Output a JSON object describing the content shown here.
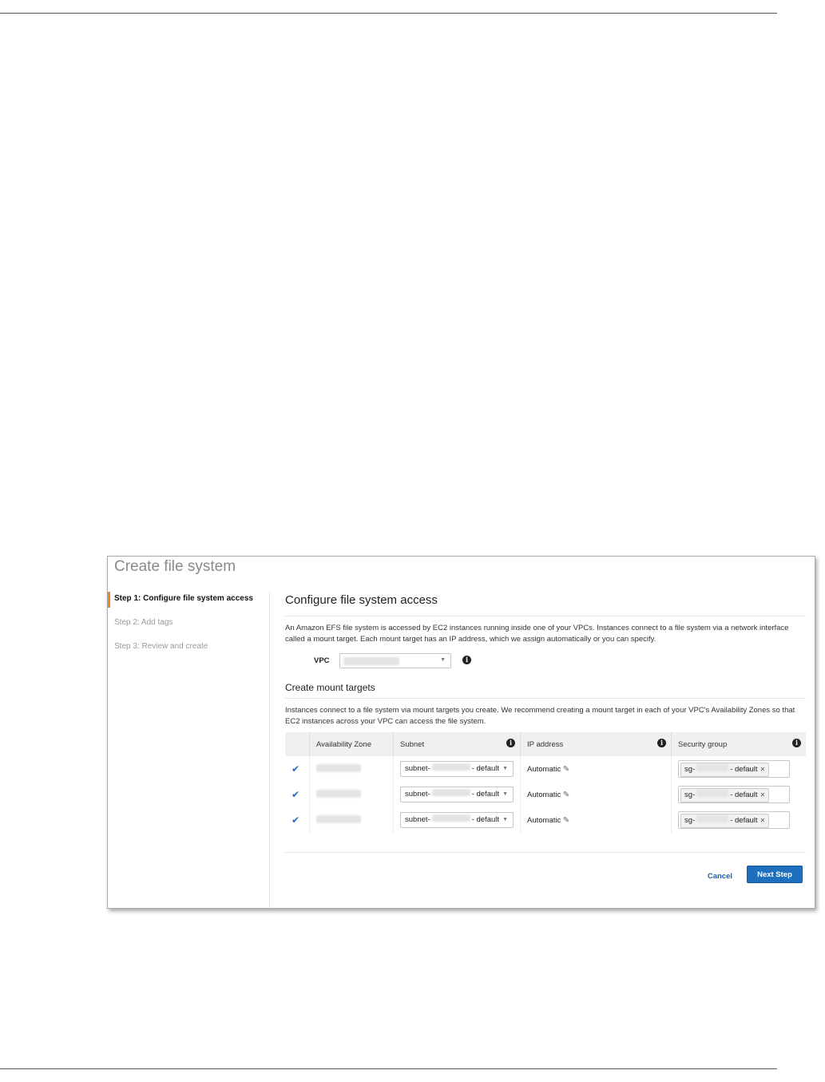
{
  "page_title": "Create file system",
  "steps": [
    {
      "label": "Step 1: Configure file system access",
      "active": true
    },
    {
      "label": "Step 2: Add tags",
      "active": false
    },
    {
      "label": "Step 3: Review and create",
      "active": false
    }
  ],
  "section_title": "Configure file system access",
  "intro": "An Amazon EFS file system is accessed by EC2 instances running inside one of your VPCs. Instances connect to a file system via a network interface called a mount target. Each mount target has an IP address, which we assign automatically or you can specify.",
  "vpc": {
    "label": "VPC",
    "value": ""
  },
  "mount_targets": {
    "title": "Create mount targets",
    "description": "Instances connect to a file system via mount targets you create. We recommend creating a mount target in each of your VPC's Availability Zones so that EC2 instances across your VPC can access the file system.",
    "columns": {
      "az": "Availability Zone",
      "subnet": "Subnet",
      "ip": "IP address",
      "sg": "Security group"
    },
    "rows": [
      {
        "checked": true,
        "subnet_prefix": "subnet-",
        "subnet_suffix": "- default",
        "ip": "Automatic",
        "sg_prefix": "sg-",
        "sg_suffix": "- default"
      },
      {
        "checked": true,
        "subnet_prefix": "subnet-",
        "subnet_suffix": "- default",
        "ip": "Automatic",
        "sg_prefix": "sg-",
        "sg_suffix": "- default"
      },
      {
        "checked": true,
        "subnet_prefix": "subnet-",
        "subnet_suffix": "- default",
        "ip": "Automatic",
        "sg_prefix": "sg-",
        "sg_suffix": "- default"
      }
    ]
  },
  "buttons": {
    "cancel": "Cancel",
    "next": "Next Step"
  },
  "colors": {
    "active_step": "#e8862b",
    "primary_button": "#1f6fbf",
    "link": "#1a5fa8",
    "checkbox": "#1a72c7"
  }
}
